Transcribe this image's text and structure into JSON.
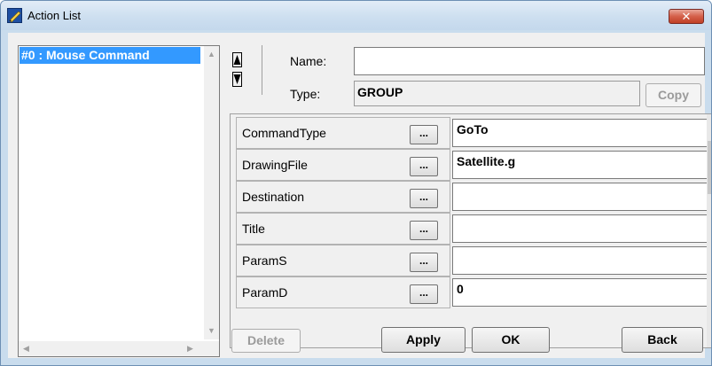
{
  "window": {
    "title": "Action List"
  },
  "list": {
    "items": [
      "#0 : Mouse Command"
    ]
  },
  "header": {
    "name_label": "Name:",
    "name_value": "",
    "type_label": "Type:",
    "type_value": "GROUP",
    "copy_label": "Copy"
  },
  "properties": [
    {
      "name": "CommandType",
      "value": "GoTo"
    },
    {
      "name": "DrawingFile",
      "value": "Satellite.g"
    },
    {
      "name": "Destination",
      "value": ""
    },
    {
      "name": "Title",
      "value": ""
    },
    {
      "name": "ParamS",
      "value": ""
    },
    {
      "name": "ParamD",
      "value": "0"
    }
  ],
  "dots_label": "...",
  "buttons": {
    "delete": "Delete",
    "apply": "Apply",
    "ok": "OK",
    "back": "Back"
  },
  "colors": {
    "selection": "#3399ff",
    "close": "#c9473a",
    "client": "#f0f0f0"
  }
}
